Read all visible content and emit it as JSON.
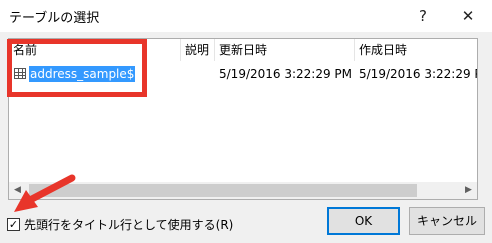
{
  "window": {
    "title": "テーブルの選択",
    "help_glyph": "?",
    "close_glyph": "✕"
  },
  "table": {
    "columns": [
      "名前",
      "説明",
      "更新日時",
      "作成日時"
    ],
    "rows": [
      {
        "name": "address_sample$",
        "description": "",
        "modified": "5/19/2016 3:22:29 PM",
        "created": "5/19/2016 3:22:29 PM",
        "icon": "table-icon",
        "selected": true
      }
    ]
  },
  "scrollbar": {
    "left_glyph": "◀",
    "right_glyph": "▶"
  },
  "options": {
    "first_row_title_label": "先頭行をタイトル行として使用する(R)",
    "first_row_title_checked": true,
    "check_glyph": "✓"
  },
  "buttons": {
    "ok": "OK",
    "cancel": "キャンセル"
  },
  "annotation_color": "#e8352a"
}
